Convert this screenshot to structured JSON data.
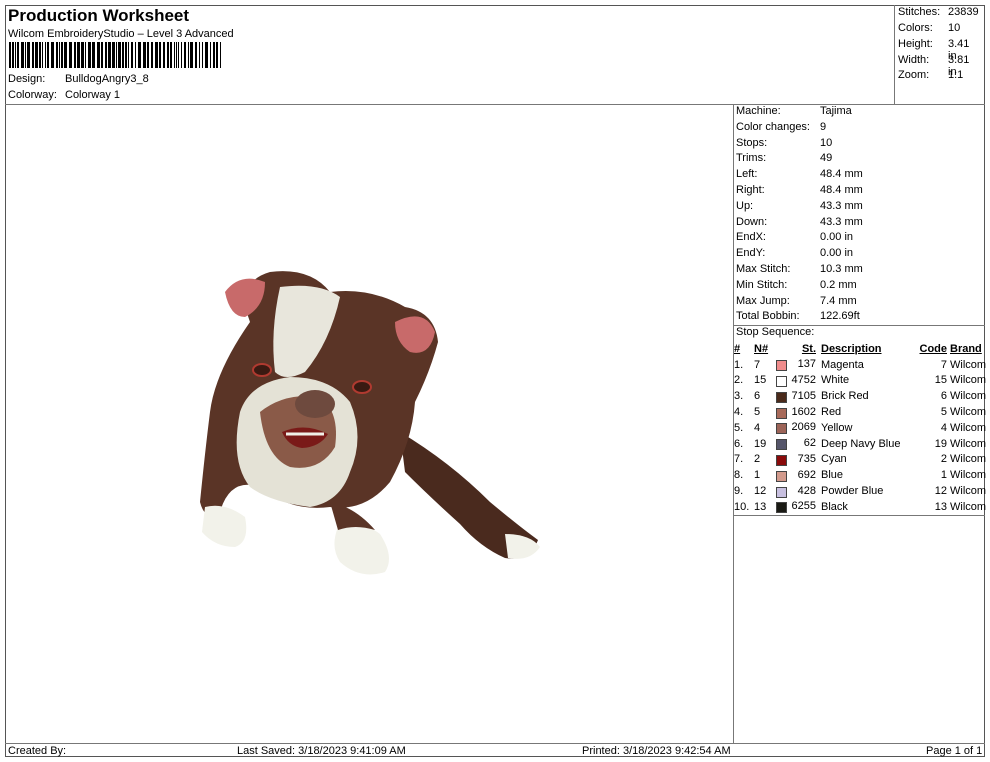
{
  "header": {
    "title": "Production Worksheet",
    "subtitle": "Wilcom EmbroideryStudio – Level 3 Advanced",
    "design_label": "Design:",
    "design_value": "BulldogAngry3_8",
    "colorway_label": "Colorway:",
    "colorway_value": "Colorway 1"
  },
  "stats": [
    {
      "label": "Stitches:",
      "value": "23839"
    },
    {
      "label": "Colors:",
      "value": "10"
    },
    {
      "label": "Height:",
      "value": "3.41 in"
    },
    {
      "label": "Width:",
      "value": "3.81 in"
    },
    {
      "label": "Zoom:",
      "value": "1:1"
    }
  ],
  "machine": [
    {
      "label": "Machine:",
      "value": "Tajima"
    },
    {
      "label": "Color changes:",
      "value": "9"
    },
    {
      "label": "Stops:",
      "value": "10"
    },
    {
      "label": "Trims:",
      "value": "49"
    },
    {
      "label": "Left:",
      "value": "48.4 mm"
    },
    {
      "label": "Right:",
      "value": "48.4 mm"
    },
    {
      "label": "Up:",
      "value": "43.3 mm"
    },
    {
      "label": "Down:",
      "value": "43.3 mm"
    },
    {
      "label": "EndX:",
      "value": "0.00 in"
    },
    {
      "label": "EndY:",
      "value": "0.00 in"
    },
    {
      "label": "Max Stitch:",
      "value": "10.3 mm"
    },
    {
      "label": "Min Stitch:",
      "value": "0.2 mm"
    },
    {
      "label": "Max Jump:",
      "value": "7.4 mm"
    },
    {
      "label": "Total Bobbin:",
      "value": "122.69ft"
    }
  ],
  "stop_sequence": {
    "title": "Stop Sequence:",
    "headers": {
      "num": "#",
      "n": "N#",
      "st": "St.",
      "desc": "Description",
      "code": "Code",
      "brand": "Brand"
    },
    "rows": [
      {
        "num": "1.",
        "n": "7",
        "color": "#f08c8c",
        "st": "137",
        "desc": "Magenta",
        "code": "7",
        "brand": "Wilcom"
      },
      {
        "num": "2.",
        "n": "15",
        "color": "#ffffff",
        "st": "4752",
        "desc": "White",
        "code": "15",
        "brand": "Wilcom"
      },
      {
        "num": "3.",
        "n": "6",
        "color": "#4a2a1a",
        "st": "7105",
        "desc": "Brick Red",
        "code": "6",
        "brand": "Wilcom"
      },
      {
        "num": "4.",
        "n": "5",
        "color": "#a86a5a",
        "st": "1602",
        "desc": "Red",
        "code": "5",
        "brand": "Wilcom"
      },
      {
        "num": "5.",
        "n": "4",
        "color": "#9c6458",
        "st": "2069",
        "desc": "Yellow",
        "code": "4",
        "brand": "Wilcom"
      },
      {
        "num": "6.",
        "n": "19",
        "color": "#55556a",
        "st": "62",
        "desc": "Deep Navy Blue",
        "code": "19",
        "brand": "Wilcom"
      },
      {
        "num": "7.",
        "n": "2",
        "color": "#8a0a0a",
        "st": "735",
        "desc": "Cyan",
        "code": "2",
        "brand": "Wilcom"
      },
      {
        "num": "8.",
        "n": "1",
        "color": "#d29a8c",
        "st": "692",
        "desc": "Blue",
        "code": "1",
        "brand": "Wilcom"
      },
      {
        "num": "9.",
        "n": "12",
        "color": "#c8c0e0",
        "st": "428",
        "desc": "Powder Blue",
        "code": "12",
        "brand": "Wilcom"
      },
      {
        "num": "10.",
        "n": "13",
        "color": "#1a1a14",
        "st": "6255",
        "desc": "Black",
        "code": "13",
        "brand": "Wilcom"
      }
    ]
  },
  "footer": {
    "created_by": "Created By:",
    "last_saved": "Last Saved: 3/18/2023 9:41:09 AM",
    "printed": "Printed: 3/18/2023 9:42:54 AM",
    "page": "Page 1 of 1"
  },
  "design_image": {
    "icon": "bulldog-embroidery-image"
  }
}
